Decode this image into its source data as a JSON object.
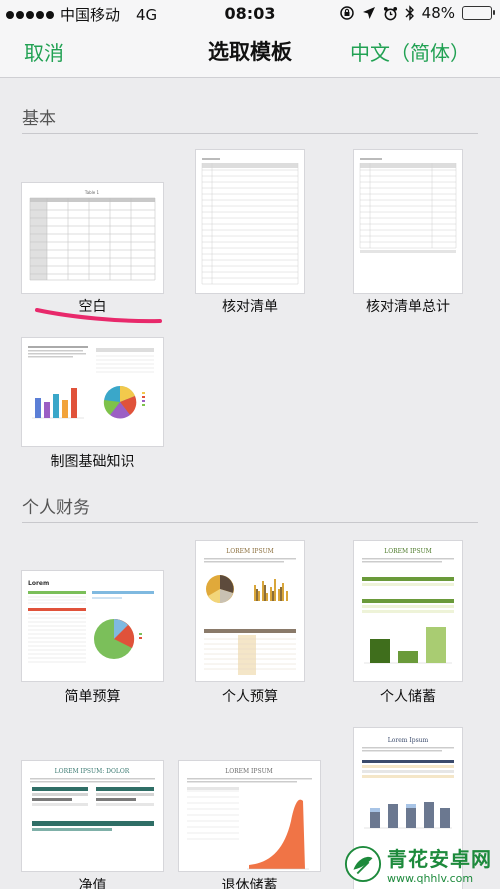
{
  "status_bar": {
    "carrier": "中国移动",
    "network": "4G",
    "time": "08:03",
    "battery": "48%",
    "battery_level": 0.48
  },
  "nav": {
    "cancel_label": "取消",
    "title": "选取模板",
    "language_label": "中文（简体）"
  },
  "sections": {
    "basic": {
      "title": "基本",
      "templates": [
        "空白",
        "核对清单",
        "核对清单总计",
        "制图基础知识"
      ]
    },
    "personal_finance": {
      "title": "个人财务",
      "templates": [
        "简单预算",
        "个人预算",
        "个人储蓄",
        "净值",
        "退休储蓄"
      ]
    }
  },
  "thumbnails": {
    "blank_title": "Table 1",
    "lorem": "LOREM IPSUM",
    "lorem_dolor": "LOREM IPSUM: DOLOR",
    "lorem_small": "Lorem",
    "lorem_ipsum_small": "Lorem Ipsum"
  },
  "colors": {
    "accent": "#21a153",
    "highlight_stroke": "#e8296b",
    "background": "#ececee"
  },
  "watermark": {
    "name": "青花安卓网",
    "url": "www.qhhlv.com"
  }
}
